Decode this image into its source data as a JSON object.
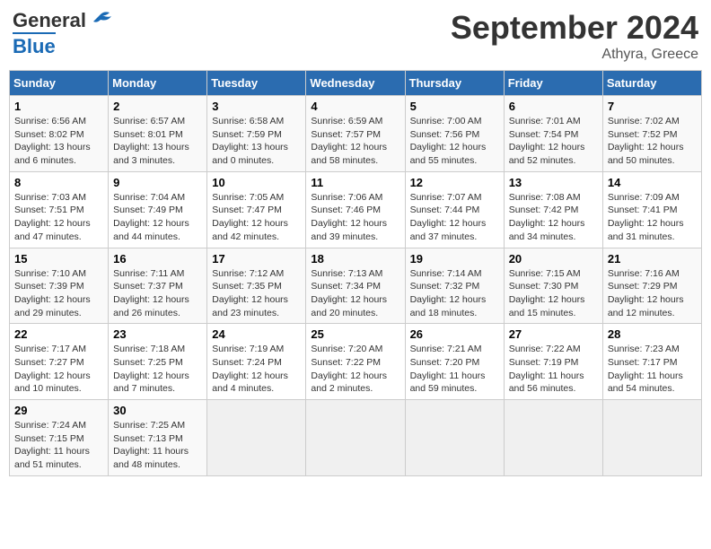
{
  "header": {
    "logo_general": "General",
    "logo_blue": "Blue",
    "month_title": "September 2024",
    "location": "Athyra, Greece"
  },
  "columns": [
    "Sunday",
    "Monday",
    "Tuesday",
    "Wednesday",
    "Thursday",
    "Friday",
    "Saturday"
  ],
  "rows": [
    [
      {
        "day": "1",
        "info": "Sunrise: 6:56 AM\nSunset: 8:02 PM\nDaylight: 13 hours\nand 6 minutes."
      },
      {
        "day": "2",
        "info": "Sunrise: 6:57 AM\nSunset: 8:01 PM\nDaylight: 13 hours\nand 3 minutes."
      },
      {
        "day": "3",
        "info": "Sunrise: 6:58 AM\nSunset: 7:59 PM\nDaylight: 13 hours\nand 0 minutes."
      },
      {
        "day": "4",
        "info": "Sunrise: 6:59 AM\nSunset: 7:57 PM\nDaylight: 12 hours\nand 58 minutes."
      },
      {
        "day": "5",
        "info": "Sunrise: 7:00 AM\nSunset: 7:56 PM\nDaylight: 12 hours\nand 55 minutes."
      },
      {
        "day": "6",
        "info": "Sunrise: 7:01 AM\nSunset: 7:54 PM\nDaylight: 12 hours\nand 52 minutes."
      },
      {
        "day": "7",
        "info": "Sunrise: 7:02 AM\nSunset: 7:52 PM\nDaylight: 12 hours\nand 50 minutes."
      }
    ],
    [
      {
        "day": "8",
        "info": "Sunrise: 7:03 AM\nSunset: 7:51 PM\nDaylight: 12 hours\nand 47 minutes."
      },
      {
        "day": "9",
        "info": "Sunrise: 7:04 AM\nSunset: 7:49 PM\nDaylight: 12 hours\nand 44 minutes."
      },
      {
        "day": "10",
        "info": "Sunrise: 7:05 AM\nSunset: 7:47 PM\nDaylight: 12 hours\nand 42 minutes."
      },
      {
        "day": "11",
        "info": "Sunrise: 7:06 AM\nSunset: 7:46 PM\nDaylight: 12 hours\nand 39 minutes."
      },
      {
        "day": "12",
        "info": "Sunrise: 7:07 AM\nSunset: 7:44 PM\nDaylight: 12 hours\nand 37 minutes."
      },
      {
        "day": "13",
        "info": "Sunrise: 7:08 AM\nSunset: 7:42 PM\nDaylight: 12 hours\nand 34 minutes."
      },
      {
        "day": "14",
        "info": "Sunrise: 7:09 AM\nSunset: 7:41 PM\nDaylight: 12 hours\nand 31 minutes."
      }
    ],
    [
      {
        "day": "15",
        "info": "Sunrise: 7:10 AM\nSunset: 7:39 PM\nDaylight: 12 hours\nand 29 minutes."
      },
      {
        "day": "16",
        "info": "Sunrise: 7:11 AM\nSunset: 7:37 PM\nDaylight: 12 hours\nand 26 minutes."
      },
      {
        "day": "17",
        "info": "Sunrise: 7:12 AM\nSunset: 7:35 PM\nDaylight: 12 hours\nand 23 minutes."
      },
      {
        "day": "18",
        "info": "Sunrise: 7:13 AM\nSunset: 7:34 PM\nDaylight: 12 hours\nand 20 minutes."
      },
      {
        "day": "19",
        "info": "Sunrise: 7:14 AM\nSunset: 7:32 PM\nDaylight: 12 hours\nand 18 minutes."
      },
      {
        "day": "20",
        "info": "Sunrise: 7:15 AM\nSunset: 7:30 PM\nDaylight: 12 hours\nand 15 minutes."
      },
      {
        "day": "21",
        "info": "Sunrise: 7:16 AM\nSunset: 7:29 PM\nDaylight: 12 hours\nand 12 minutes."
      }
    ],
    [
      {
        "day": "22",
        "info": "Sunrise: 7:17 AM\nSunset: 7:27 PM\nDaylight: 12 hours\nand 10 minutes."
      },
      {
        "day": "23",
        "info": "Sunrise: 7:18 AM\nSunset: 7:25 PM\nDaylight: 12 hours\nand 7 minutes."
      },
      {
        "day": "24",
        "info": "Sunrise: 7:19 AM\nSunset: 7:24 PM\nDaylight: 12 hours\nand 4 minutes."
      },
      {
        "day": "25",
        "info": "Sunrise: 7:20 AM\nSunset: 7:22 PM\nDaylight: 12 hours\nand 2 minutes."
      },
      {
        "day": "26",
        "info": "Sunrise: 7:21 AM\nSunset: 7:20 PM\nDaylight: 11 hours\nand 59 minutes."
      },
      {
        "day": "27",
        "info": "Sunrise: 7:22 AM\nSunset: 7:19 PM\nDaylight: 11 hours\nand 56 minutes."
      },
      {
        "day": "28",
        "info": "Sunrise: 7:23 AM\nSunset: 7:17 PM\nDaylight: 11 hours\nand 54 minutes."
      }
    ],
    [
      {
        "day": "29",
        "info": "Sunrise: 7:24 AM\nSunset: 7:15 PM\nDaylight: 11 hours\nand 51 minutes."
      },
      {
        "day": "30",
        "info": "Sunrise: 7:25 AM\nSunset: 7:13 PM\nDaylight: 11 hours\nand 48 minutes."
      },
      null,
      null,
      null,
      null,
      null
    ]
  ]
}
